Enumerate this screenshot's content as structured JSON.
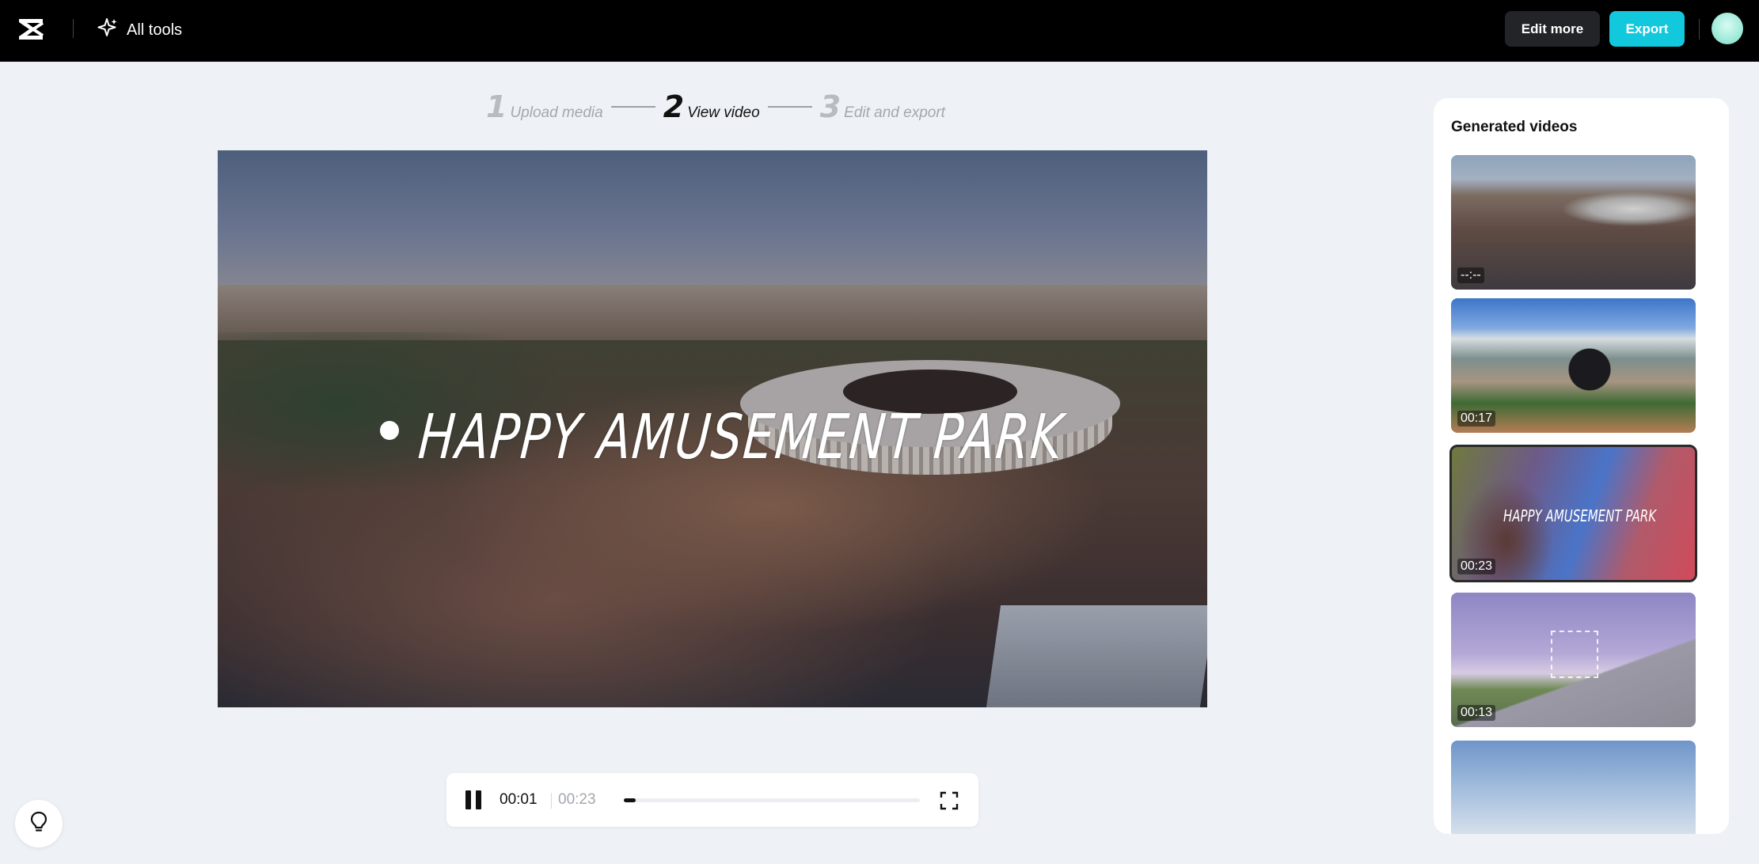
{
  "topbar": {
    "all_tools_label": "All tools",
    "edit_more_label": "Edit more",
    "export_label": "Export"
  },
  "stepper": {
    "steps": [
      {
        "num": "1",
        "label": "Upload media",
        "active": false
      },
      {
        "num": "2",
        "label": "View video",
        "active": true
      },
      {
        "num": "3",
        "label": "Edit and export",
        "active": false
      }
    ]
  },
  "preview": {
    "title_text": "HAPPY AMUSEMENT PARK"
  },
  "player": {
    "current_time": "00:01",
    "total_time": "00:23",
    "progress_fraction": 0.04
  },
  "sidebar": {
    "title": "Generated videos",
    "videos": [
      {
        "duration": "--:--",
        "selected": false
      },
      {
        "duration": "00:17",
        "selected": false
      },
      {
        "duration": "00:23",
        "selected": true,
        "overlay_text": "HAPPY AMUSEMENT PARK"
      },
      {
        "duration": "00:13",
        "selected": false
      },
      {
        "duration": "",
        "selected": false
      }
    ]
  },
  "colors": {
    "topbar_bg": "#000000",
    "accent_export": "#12c8dc",
    "page_bg": "#eef2f6"
  },
  "icons": {
    "logo": "capcut-logo-icon",
    "all_tools": "sparkle-icon",
    "pause": "pause-icon",
    "fullscreen": "fullscreen-icon",
    "tips": "lightbulb-icon"
  }
}
